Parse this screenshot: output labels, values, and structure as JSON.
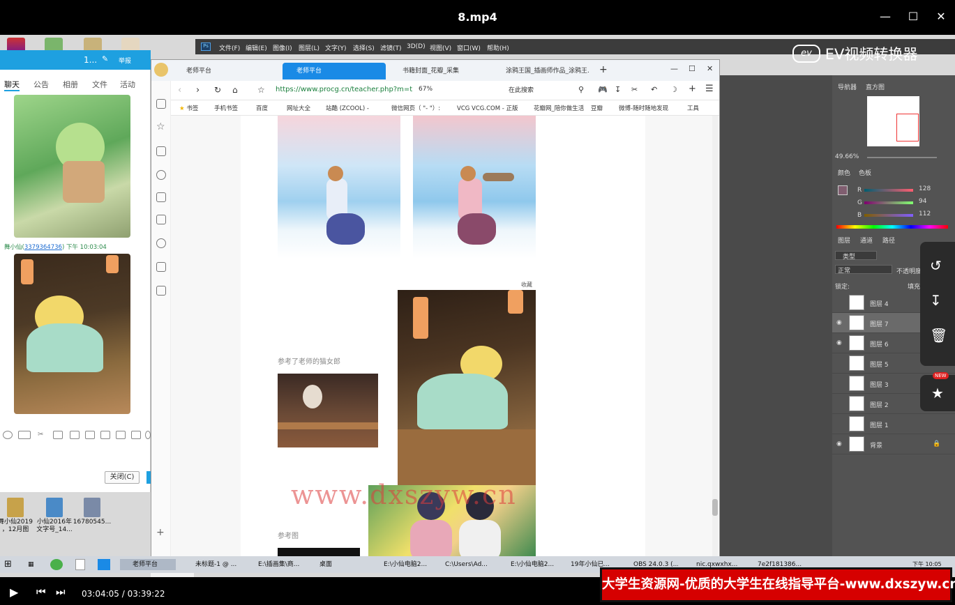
{
  "window": {
    "title": "8.mp4"
  },
  "ev": {
    "label": "EV视频转换器"
  },
  "qq": {
    "title": "1...",
    "report": "举报",
    "tabs": [
      "聊天",
      "公告",
      "相册",
      "文件",
      "活动"
    ],
    "sender": "舞小仙",
    "sender_id": "3379364736",
    "sender_time": ") 下午 10:03:04",
    "close_button": "关闭(C)"
  },
  "desktop_files": [
    {
      "label": "舞小仙2019\n，12月图"
    },
    {
      "label": "小仙2016年\n文字号_14..."
    },
    {
      "label": "16780545..."
    }
  ],
  "ps": {
    "menu": [
      "文件(F)",
      "编辑(E)",
      "图像(I)",
      "图层(L)",
      "文字(Y)",
      "选择(S)",
      "滤镜(T)",
      "3D(D)",
      "视图(V)",
      "窗口(W)",
      "帮助(H)"
    ],
    "navigator_tabs": [
      "导航器",
      "直方图"
    ],
    "zoom": "49.66%",
    "color_tabs": [
      "颜色",
      "色板"
    ],
    "rgb": {
      "r": "128",
      "g": "94",
      "b": "112"
    },
    "layer_tabs": [
      "图层",
      "通道",
      "路径"
    ],
    "layer_filter": "类型",
    "blend_mode": "正常",
    "opacity_label": "不透明度",
    "lock_label": "锁定:",
    "fill_label": "填充",
    "layers": [
      "图层 4",
      "图层 7",
      "图层 6",
      "图层 5",
      "图层 3",
      "图层 2",
      "图层 1",
      "背景"
    ]
  },
  "browser": {
    "tabs": [
      "老师平台",
      "老师平台",
      "书籍封面_花瓣_采集",
      "涂鸦王国_插画师作品_涂鸦王..."
    ],
    "url": "https://www.procg.cn/teacher.php?m=t",
    "zoom": "67%",
    "search_placeholder": "在此搜索",
    "bookmarks": [
      "书签",
      "手机书签",
      "百度",
      "网址大全",
      "站酷 (ZCOOL) -",
      "微信网页（ \"- \"）:",
      "VCG VCG.COM - 正版",
      "花瓣网_陪你做生活",
      "豆瓣",
      "微博-随时随地发现",
      "工具"
    ],
    "collect_label": "收藏",
    "caption1": "参考了老师的猫女郎",
    "caption2": "参考图",
    "watermark": "www.dxszyw.cn"
  },
  "taskbar": {
    "items": [
      "老师平台",
      "未标题-1 @ ...",
      "E:\\插画集\\商...",
      "桌面",
      "E:\\小仙电脑2...",
      "C:\\Users\\Ad...",
      "E:\\小仙电脑2...",
      "19年小仙已...",
      "OBS 24.0.3 (...",
      "nic.qxwxhx...",
      "7e2f181386..."
    ],
    "clock": "下午 10:05"
  },
  "player": {
    "time": "03:04:05 / 03:39:22"
  },
  "banner": {
    "text": "大学生资源网-优质的大学生在线指导平台-www.dxszyw.cn"
  },
  "float_tools": {
    "new_badge": "NEW"
  }
}
